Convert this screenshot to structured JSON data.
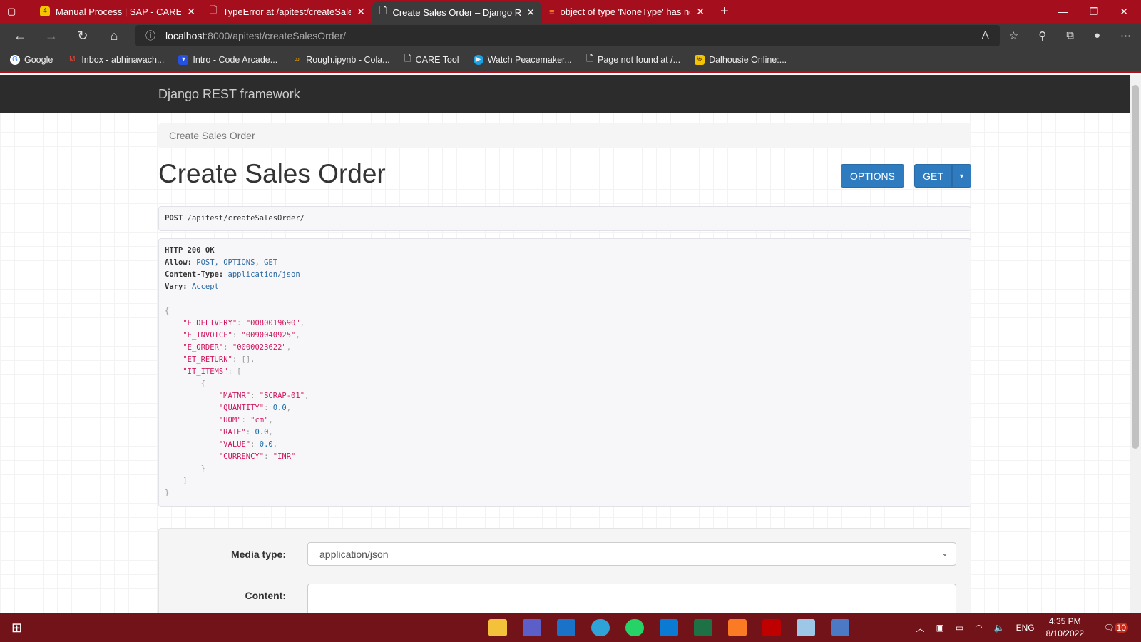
{
  "browser": {
    "tabs": [
      {
        "title": "Manual Process | SAP - CARE",
        "icon": "sap-care-icon"
      },
      {
        "title": "TypeError at /apitest/createSalesOrder",
        "icon": "page-icon"
      },
      {
        "title": "Create Sales Order – Django REST framework",
        "icon": "page-icon"
      },
      {
        "title": "object of type 'NoneType' has no len()",
        "icon": "stackoverflow-icon"
      }
    ],
    "url_host": "localhost",
    "url_path": ":8000/apitest/createSalesOrder/",
    "bookmarks": [
      "Google",
      "Inbox - abhinavach...",
      "Intro - Code Arcade...",
      "Rough.ipynb - Cola...",
      "CARE Tool",
      "Watch Peacemaker...",
      "Page not found at /...",
      "Dalhousie Online:..."
    ]
  },
  "navbar": {
    "brand": "Django REST framework"
  },
  "breadcrumb": "Create Sales Order",
  "page": {
    "title": "Create Sales Order",
    "options_label": "OPTIONS",
    "get_label": "GET"
  },
  "request": {
    "method": "POST",
    "path": "/apitest/createSalesOrder/"
  },
  "response": {
    "status": "HTTP 200 OK",
    "allow_label": "Allow:",
    "allow": "POST, OPTIONS, GET",
    "ct_label": "Content-Type:",
    "ct": "application/json",
    "vary_label": "Vary:",
    "vary": "Accept",
    "body": {
      "E_DELIVERY": "0080019690",
      "E_INVOICE": "0090040925",
      "E_ORDER": "0000023622",
      "ET_RETURN": "[]",
      "IT_ITEMS": [
        {
          "MATNR": "SCRAP-01",
          "QUANTITY": "0.0",
          "UOM": "cm",
          "RATE": "0.0",
          "VALUE": "0.0",
          "CURRENCY": "INR"
        }
      ]
    }
  },
  "form": {
    "media_type_label": "Media type:",
    "media_type": "application/json",
    "content_label": "Content:"
  },
  "taskbar": {
    "time": "4:35 PM",
    "date": "8/10/2022",
    "lang": "ENG",
    "notifications": "10"
  }
}
